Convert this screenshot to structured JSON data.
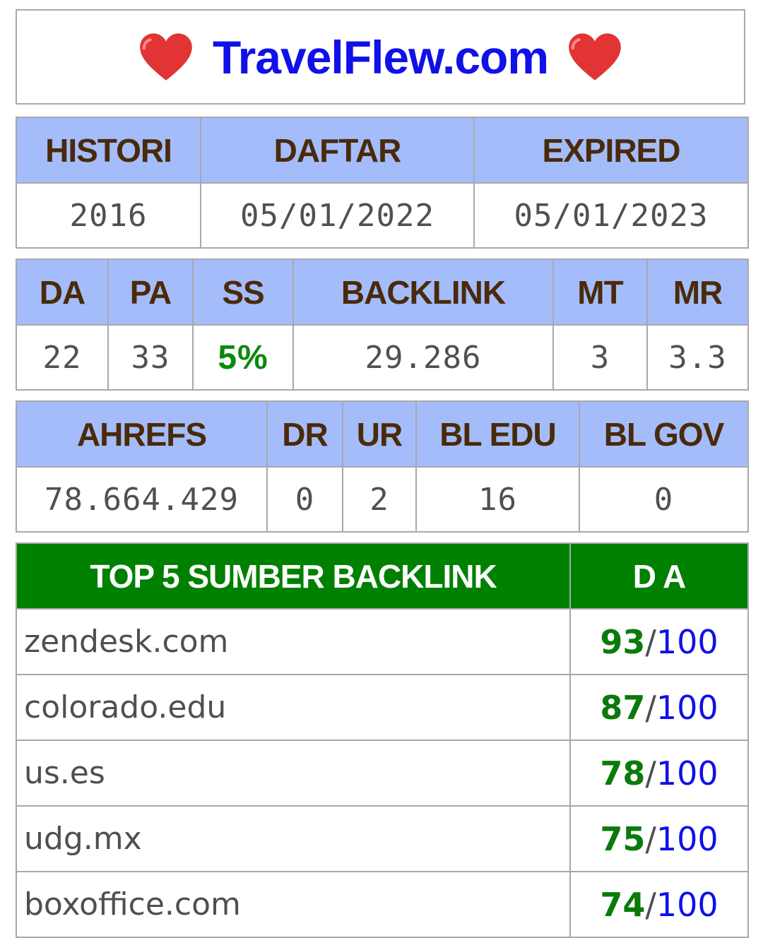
{
  "header": {
    "site": "TravelFlew.com",
    "left_icon": "heart-icon",
    "right_icon": "heart-icon",
    "heart_color": "#e23434"
  },
  "registration": {
    "headers": [
      "HISTORI",
      "DAFTAR",
      "EXPIRED"
    ],
    "values": [
      "2016",
      "05/01/2022",
      "05/01/2023"
    ]
  },
  "moz_metrics": {
    "headers": [
      "DA",
      "PA",
      "SS",
      "BACKLINK",
      "MT",
      "MR"
    ],
    "values": [
      "22",
      "33",
      "5%",
      "29.286",
      "3",
      "3.3"
    ]
  },
  "ahrefs_metrics": {
    "headers": [
      "AHREFS",
      "DR",
      "UR",
      "BL EDU",
      "BL GOV"
    ],
    "values": [
      "78.664.429",
      "0",
      "2",
      "16",
      "0"
    ]
  },
  "top_backlinks": {
    "headers": [
      "TOP 5 SUMBER BACKLINK",
      "D A"
    ],
    "rows": [
      {
        "domain": "zendesk.com",
        "score": "93",
        "sep": "/",
        "max": "100"
      },
      {
        "domain": "colorado.edu",
        "score": "87",
        "sep": "/",
        "max": "100"
      },
      {
        "domain": "us.es",
        "score": "78",
        "sep": "/",
        "max": "100"
      },
      {
        "domain": "udg.mx",
        "score": "75",
        "sep": "/",
        "max": "100"
      },
      {
        "domain": "boxoffice.com",
        "score": "74",
        "sep": "/",
        "max": "100"
      }
    ]
  },
  "colors": {
    "header_blue": "#a4bcfa",
    "header_green": "#008000",
    "title_blue": "#1010e8",
    "score_green": "#0a7a0a"
  }
}
